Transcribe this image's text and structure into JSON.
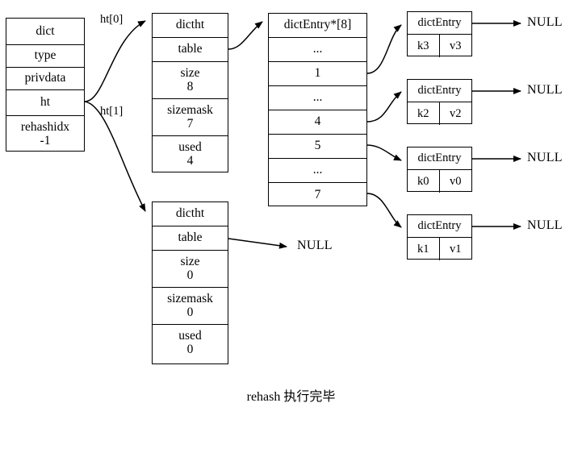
{
  "diagram": {
    "caption": "rehash 执行完毕",
    "dict": {
      "title": "dict",
      "fields": [
        {
          "label": "type",
          "value": ""
        },
        {
          "label": "privdata",
          "value": ""
        },
        {
          "label": "ht",
          "value": ""
        },
        {
          "label": "rehashidx",
          "value": "-1"
        }
      ]
    },
    "ht_labels": {
      "ht0": "ht[0]",
      "ht1": "ht[1]"
    },
    "dictht0": {
      "title": "dictht",
      "table_label": "table",
      "size_label": "size",
      "size_value": "8",
      "sizemask_label": "sizemask",
      "sizemask_value": "7",
      "used_label": "used",
      "used_value": "4"
    },
    "dictht1": {
      "title": "dictht",
      "table_label": "table",
      "table_target": "NULL",
      "size_label": "size",
      "size_value": "0",
      "sizemask_label": "sizemask",
      "sizemask_value": "0",
      "used_label": "used",
      "used_value": "0"
    },
    "bucket_array": {
      "header": "dictEntry*[8]",
      "rows": [
        "...",
        "1",
        "...",
        "4",
        "5",
        "...",
        "7"
      ]
    },
    "entries": [
      {
        "name": "dictEntry",
        "key": "k3",
        "value": "v3",
        "next": "NULL"
      },
      {
        "name": "dictEntry",
        "key": "k2",
        "value": "v2",
        "next": "NULL"
      },
      {
        "name": "dictEntry",
        "key": "k0",
        "value": "v0",
        "next": "NULL"
      },
      {
        "name": "dictEntry",
        "key": "k1",
        "value": "v1",
        "next": "NULL"
      }
    ],
    "colors": {
      "stroke": "#000000",
      "background": "#ffffff"
    }
  }
}
